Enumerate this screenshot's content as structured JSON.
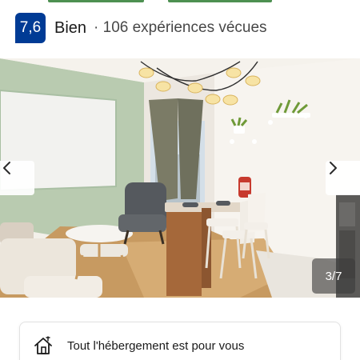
{
  "rating": {
    "score": "7,6",
    "label": "Bien",
    "reviews": "· 106 expériences vécues",
    "badge_color": "#003b95"
  },
  "gallery": {
    "counter": "3/7",
    "prev_icon": "chevron-left-icon",
    "next_icon": "chevron-right-icon"
  },
  "feature": {
    "icon": "house-icon",
    "text": "Tout l'hébergement est pour vous"
  }
}
